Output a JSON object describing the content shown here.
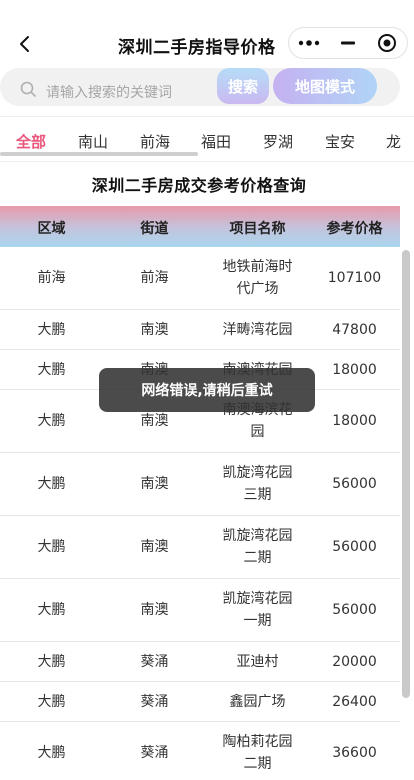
{
  "nav": {
    "title": "深圳二手房指导价格",
    "back_icon": "chevron-left-icon",
    "more_icon": "more-dots-icon",
    "minimize_icon": "minimize-icon",
    "close_icon": "target-close-icon"
  },
  "search": {
    "placeholder": "请输入搜索的关键词",
    "search_button": "搜索",
    "map_button": "地图模式",
    "icon": "search-icon"
  },
  "tabs": [
    {
      "label": "全部",
      "active": true
    },
    {
      "label": "南山",
      "active": false
    },
    {
      "label": "前海",
      "active": false
    },
    {
      "label": "福田",
      "active": false
    },
    {
      "label": "罗湖",
      "active": false
    },
    {
      "label": "宝安",
      "active": false
    },
    {
      "label": "龙",
      "active": false
    }
  ],
  "table": {
    "title": "深圳二手房成交参考价格查询",
    "headers": [
      "区域",
      "街道",
      "项目名称",
      "参考价格"
    ],
    "rows": [
      {
        "area": "前海",
        "street": "前海",
        "project": "地铁前海时代广场",
        "price": "107100"
      },
      {
        "area": "大鹏",
        "street": "南澳",
        "project": "洋畴湾花园",
        "price": "47800"
      },
      {
        "area": "大鹏",
        "street": "南澳",
        "project": "南澳湾花园",
        "price": "18000"
      },
      {
        "area": "大鹏",
        "street": "南澳",
        "project": "南澳海滨花园",
        "price": "18000"
      },
      {
        "area": "大鹏",
        "street": "南澳",
        "project": "凯旋湾花园三期",
        "price": "56000"
      },
      {
        "area": "大鹏",
        "street": "南澳",
        "project": "凯旋湾花园二期",
        "price": "56000"
      },
      {
        "area": "大鹏",
        "street": "南澳",
        "project": "凯旋湾花园一期",
        "price": "56000"
      },
      {
        "area": "大鹏",
        "street": "葵涌",
        "project": "亚迪村",
        "price": "20000"
      },
      {
        "area": "大鹏",
        "street": "葵涌",
        "project": "鑫园广场",
        "price": "26400"
      },
      {
        "area": "大鹏",
        "street": "葵涌",
        "project": "陶柏莉花园二期",
        "price": "36600"
      }
    ]
  },
  "toast": {
    "message": "网络错误,请稍后重试"
  },
  "colors": {
    "active_tab": "#e8577b",
    "toast_bg": "#323232",
    "search_bg": "#f1f1f1"
  }
}
